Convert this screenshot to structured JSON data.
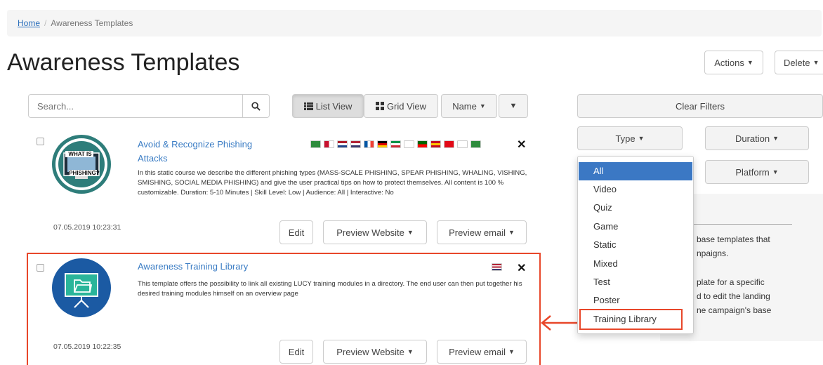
{
  "breadcrumb": {
    "home": "Home",
    "separator": "/",
    "current": "Awareness Templates"
  },
  "page_title": "Awareness Templates",
  "header_actions": {
    "actions": "Actions",
    "delete": "Delete"
  },
  "search": {
    "placeholder": "Search...",
    "icon": "search-icon"
  },
  "view_controls": {
    "list_view": "List View",
    "grid_view": "Grid View",
    "sort": "Name",
    "sort_order_icon": "caret-down-icon"
  },
  "templates": [
    {
      "title": "Avoid & Recognize Phishing Attacks",
      "description": "In this static course we describe the different phishing types (MASS-SCALE PHISHING, SPEAR PHISHING, WHALING, VISHING, SMISHING, SOCIAL MEDIA PHISHING) and give the user practical tips on how to protect themselves. All content is 100 % customizable. Duration: 5-10 Minutes | Skill Level: Low | Audience: All | Interactive: No",
      "date": "07.05.2019 10:23:31",
      "thumb_text_top": "WHAT IS",
      "thumb_text_bottom": "PHISHING?",
      "flag_count": 13,
      "edit": "Edit",
      "preview_website": "Preview Website",
      "preview_email": "Preview email"
    },
    {
      "title": "Awareness Training Library",
      "description": "This template offers the possibility to link all existing LUCY training modules in a directory. The end user can then put together his desired training modules himself on an overview page",
      "date": "07.05.2019 10:22:35",
      "flag_count": 1,
      "edit": "Edit",
      "preview_website": "Preview Website",
      "preview_email": "Preview email"
    }
  ],
  "filters": {
    "clear": "Clear Filters",
    "type": "Type",
    "duration": "Duration",
    "platform": "Platform",
    "type_options": [
      "All",
      "Video",
      "Quiz",
      "Game",
      "Static",
      "Mixed",
      "Test",
      "Poster",
      "Training Library"
    ],
    "selected_option": "All",
    "highlighted_option": "Training Library"
  },
  "info_panel": {
    "lines": [
      "base templates that",
      "npaigns.",
      "plate for a specific",
      "d to edit the landing",
      "ne campaign's base"
    ]
  },
  "colors": {
    "link": "#3a7cc4",
    "highlight": "#e8472a",
    "selected": "#3b78c4",
    "thumb_teal": "#2e7d7a",
    "thumb_blue": "#1b5aa3"
  }
}
